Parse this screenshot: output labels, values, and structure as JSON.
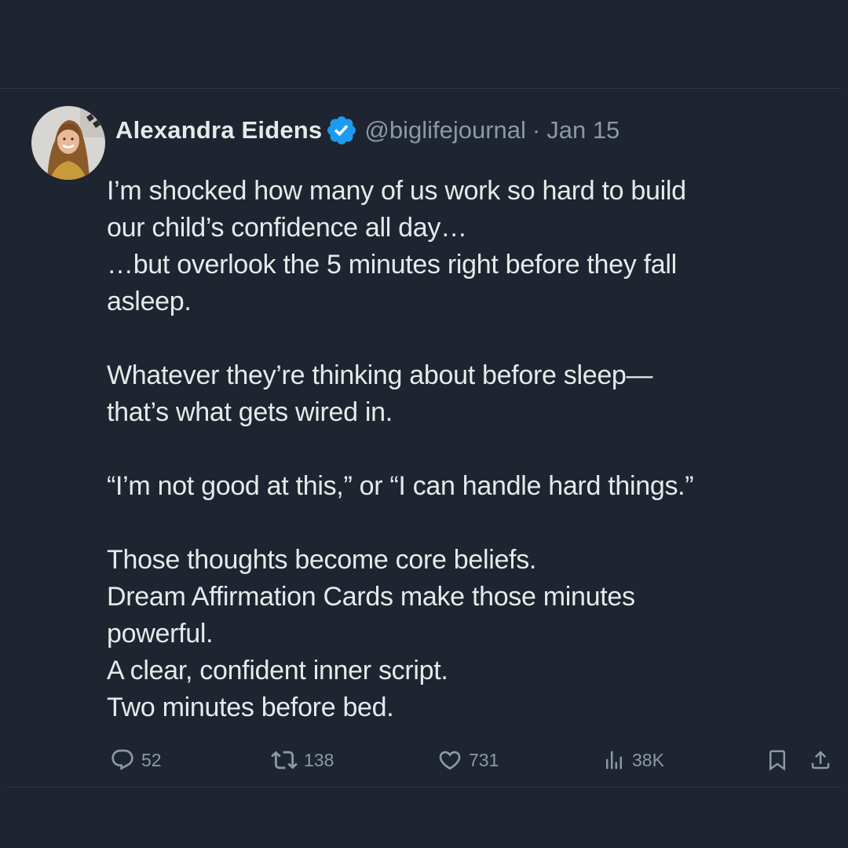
{
  "tweet": {
    "author": {
      "display_name": "Alexandra Eidens",
      "handle": "@biglifejournal",
      "verified": true,
      "avatar_icon": "profile-photo-avatar"
    },
    "separator": "·",
    "date": "Jan 15",
    "paragraphs": [
      "I’m shocked how many of us work so hard to build\nour child’s confidence all day…\n…but overlook the 5 minutes right before they fall\nasleep.",
      "Whatever they’re thinking about before sleep—\nthat’s what gets wired in.",
      "“I’m not good at this,” or “I can handle hard things.”",
      "Those thoughts become core beliefs.\nDream Affirmation Cards make those minutes\npowerful.\nA clear, confident inner script.\nTwo minutes before bed."
    ]
  },
  "actions": {
    "reply": {
      "icon": "reply-bubble-icon",
      "count": "52"
    },
    "retweet": {
      "icon": "retweet-icon",
      "count": "138"
    },
    "like": {
      "icon": "heart-icon",
      "count": "731"
    },
    "views": {
      "icon": "views-bar-chart-icon",
      "count": "38K"
    },
    "bookmark": {
      "icon": "bookmark-icon"
    },
    "share": {
      "icon": "share-upload-icon"
    }
  },
  "colors": {
    "background": "#1e2530",
    "text_primary": "#e7e9ea",
    "text_secondary": "#8b98a5",
    "verified_badge": "#1d9bf0",
    "divider": "#2f3844"
  }
}
